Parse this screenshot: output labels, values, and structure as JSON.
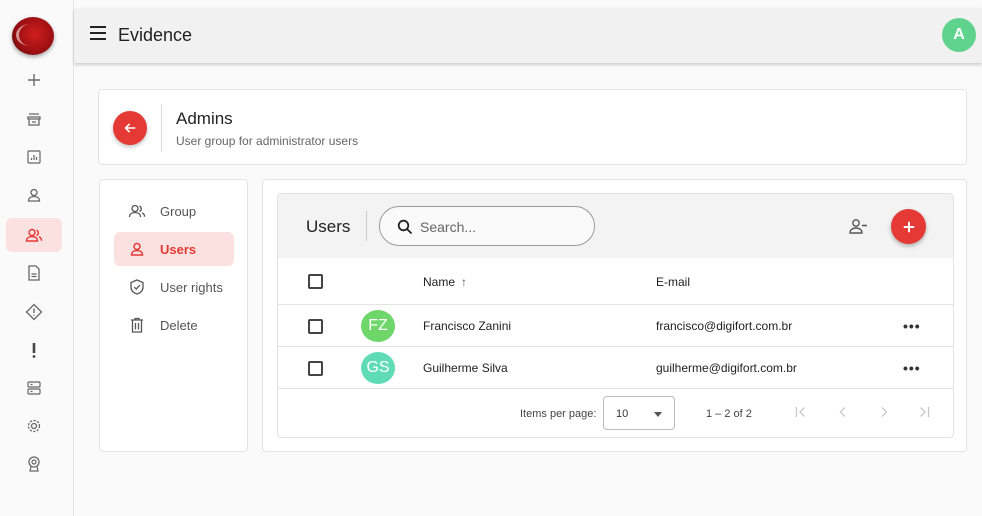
{
  "app": {
    "title": "Evidence",
    "user_initial": "A",
    "accent": "#e53935",
    "user_color": "#5fd38d"
  },
  "rail": {
    "items": [
      {
        "name": "plus-icon"
      },
      {
        "name": "archive-icon"
      },
      {
        "name": "report-icon"
      },
      {
        "name": "user-icon"
      },
      {
        "name": "user-group-icon",
        "active": true
      },
      {
        "name": "document-icon"
      },
      {
        "name": "warning-diamond-icon"
      },
      {
        "name": "exclamation-icon"
      },
      {
        "name": "server-icon"
      },
      {
        "name": "gear-icon"
      },
      {
        "name": "badge-icon"
      }
    ]
  },
  "header": {
    "title": "Admins",
    "subtitle": "User group for administrator users"
  },
  "side_menu": {
    "items": [
      {
        "label": "Group",
        "icon": "users-icon"
      },
      {
        "label": "Users",
        "icon": "user-icon",
        "active": true
      },
      {
        "label": "User rights",
        "icon": "shield-icon"
      },
      {
        "label": "Delete",
        "icon": "trash-icon"
      }
    ]
  },
  "users_panel": {
    "title": "Users",
    "search_placeholder": "Search...",
    "columns": {
      "name": "Name",
      "email": "E-mail",
      "sort_icon": "↑"
    },
    "rows": [
      {
        "initials": "FZ",
        "color": "#6fd66a",
        "name": "Francisco Zanini",
        "email": "francisco@digifort.com.br",
        "more": "•••"
      },
      {
        "initials": "GS",
        "color": "#5fdcb4",
        "name": "Guilherme Silva",
        "email": "guilherme@digifort.com.br",
        "more": "•••"
      }
    ],
    "pagination": {
      "label": "Items per page:",
      "page_size": "10",
      "range": "1 – 2 of 2"
    }
  }
}
